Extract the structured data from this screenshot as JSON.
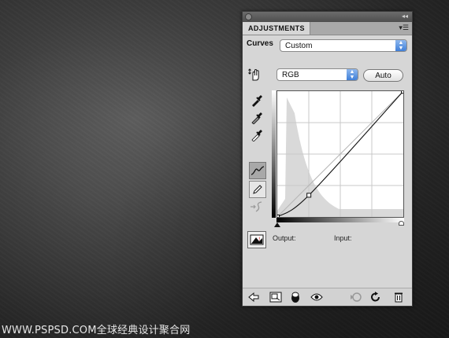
{
  "watermark": "WWW.PSPSD.COM全球经典设计聚合网",
  "panel": {
    "tab_label": "ADJUSTMENTS",
    "menu_icon": "panel-menu-icon",
    "preset_label": "Curves",
    "preset_value": "Custom",
    "channel_value": "RGB",
    "auto_label": "Auto",
    "output_label": "Output:",
    "input_label": "Input:"
  },
  "curve": {
    "points": [
      [
        0,
        0
      ],
      [
        64,
        44
      ],
      [
        255,
        255
      ]
    ],
    "histogram_color": "#d9d9d9"
  },
  "colors": {
    "accent": "#3f7fd8",
    "panel_bg": "#d6d6d6"
  }
}
